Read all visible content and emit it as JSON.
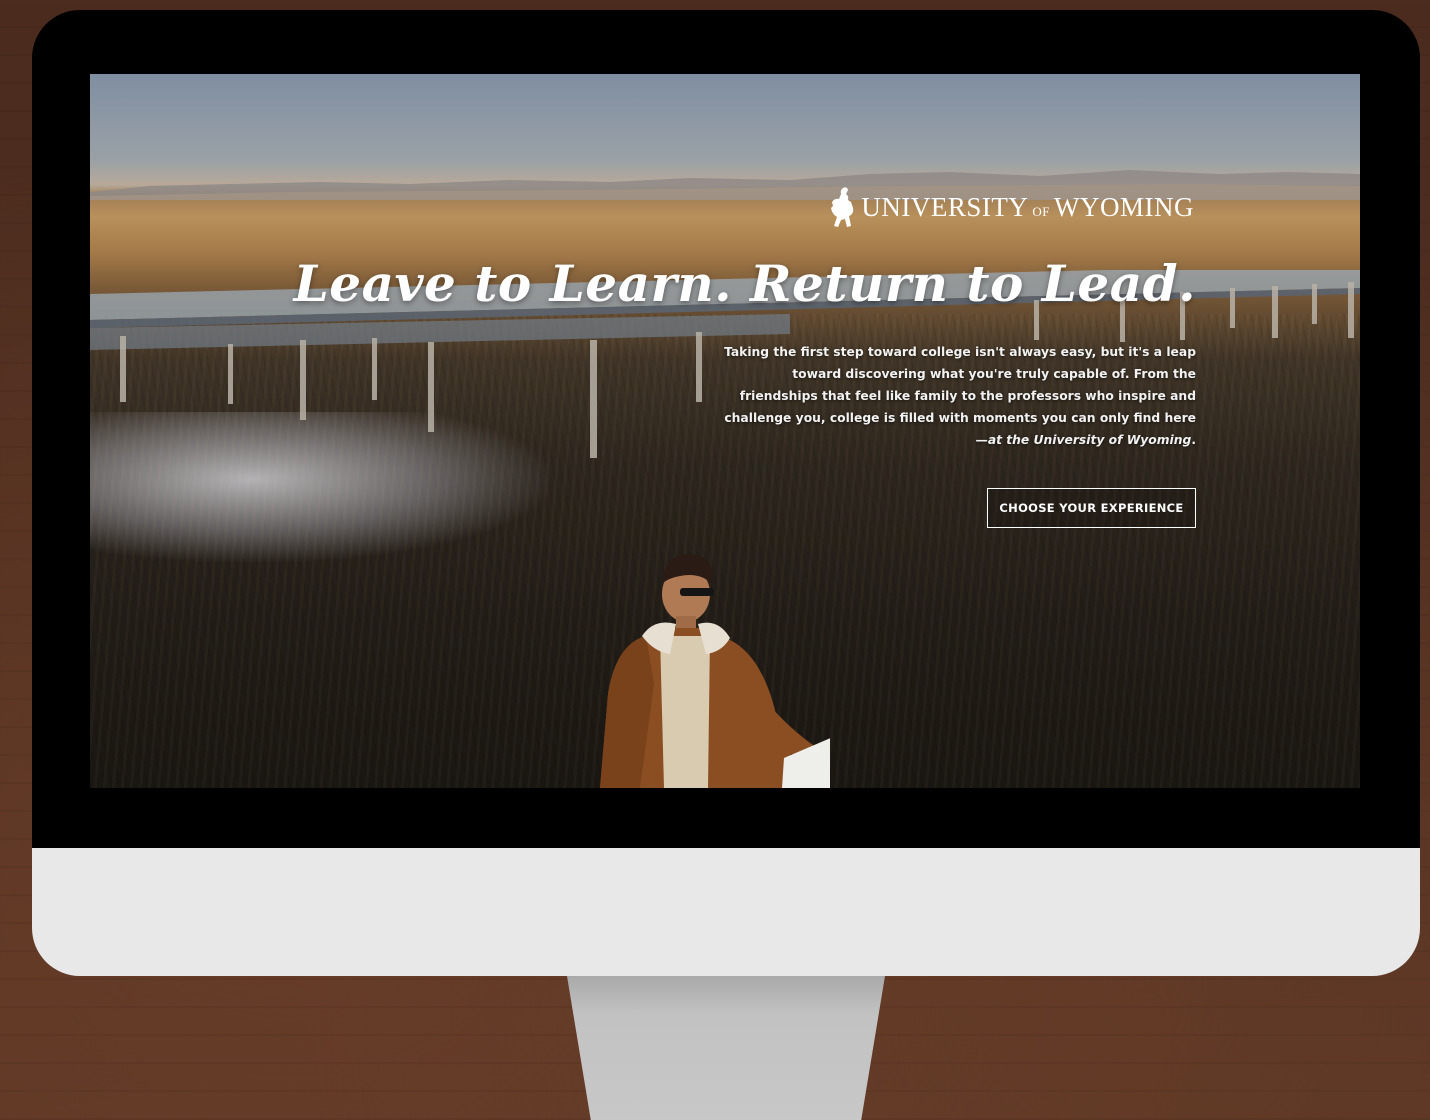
{
  "site": {
    "brand": {
      "name_primary": "UNIVERSITY",
      "name_connector": "OF",
      "name_secondary": "WYOMING",
      "icon": "bucking-horse-rider-icon"
    },
    "hero": {
      "headline": "Leave to Learn. Return to Lead.",
      "intro_main": "Taking the first step toward college isn't always easy, but it's a leap toward discovering what you're truly capable of. From the friendships that feel like family to the professors who inspire and challenge you, college is filled with moments you can only find here—",
      "intro_emphasis": "at the University of Wyoming",
      "intro_end": ".",
      "cta_label": "CHOOSE YOUR EXPERIENCE"
    }
  },
  "colors": {
    "background_wood": "#4a2b1e",
    "bezel": "#000000",
    "chin": "#e8e8e8",
    "stand": "#c2c2c2",
    "text_light": "#ffffff",
    "jacket": "#8a4e22"
  }
}
